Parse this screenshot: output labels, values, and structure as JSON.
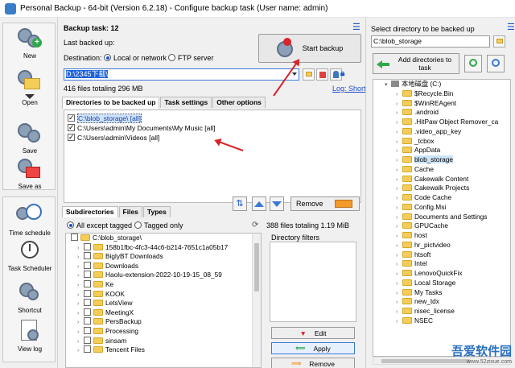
{
  "window": {
    "title": "Personal Backup - 64-bit (Version 6.2.18) - Configure backup task (User name: admin)"
  },
  "sidebar": {
    "buttons": [
      {
        "label": "New",
        "icon": "gear-add-icon"
      },
      {
        "label": "Open",
        "icon": "gear-open-icon"
      },
      {
        "label": "Save",
        "icon": "gear-save-icon"
      },
      {
        "label": "Save as",
        "icon": "gear-saveas-icon"
      },
      {
        "label": "Time schedule",
        "icon": "clock-icon"
      },
      {
        "label": "Task Scheduler",
        "icon": "task-scheduler-icon"
      },
      {
        "label": "Shortcut",
        "icon": "shortcut-icon"
      },
      {
        "label": "View log",
        "icon": "view-log-icon"
      }
    ]
  },
  "task": {
    "header": "Backup task: 12",
    "last_backed_up": "Last backed up:",
    "destination_label": "Destination:",
    "dest_local": "Local or network",
    "dest_ftp": "FTP server",
    "start_button": "Start backup",
    "path_value": "D:\\2345下载\\",
    "files_info": "416 files totaling 296 MB",
    "log_short": "Log: Short"
  },
  "tabs": [
    "Directories to be backed up",
    "Task settings",
    "Other options"
  ],
  "backup_dirs": [
    {
      "path": "C:\\blob_storage\\ [all]",
      "checked": true,
      "selected": true
    },
    {
      "path": "C:\\Users\\admin\\My Documents\\My Music [all]",
      "checked": true,
      "selected": false
    },
    {
      "path": "C:\\Users\\admin\\Videos [all]",
      "checked": true,
      "selected": false
    }
  ],
  "remove_button": "Remove",
  "subtabs": [
    "Subdirectories",
    "Files",
    "Types"
  ],
  "filter": {
    "all_except": "All except tagged",
    "tagged_only": "Tagged only",
    "total": "388 files totaling 1.19 MiB",
    "dir_filters_label": "Directory filters",
    "edit": "Edit",
    "apply": "Apply",
    "remove": "Remove"
  },
  "subdir_root": "C:\\blob_storage\\",
  "subdirs": [
    "158b1fbc-4fc3-44c6-b214-7651c1a05b17",
    "BiglyBT Downloads",
    "Downloads",
    "Haolu-extension-2022-10-19-15_08_59",
    "Ke",
    "KOOK",
    "LetsView",
    "MeetingX",
    "PersBackup",
    "Processing",
    "sinsam",
    "Tencent Files"
  ],
  "right": {
    "select_label": "Select directory to be backed up",
    "path_value": "C:\\blob_storage",
    "add_button": "Add directories to task",
    "root": "本地磁盘 (C:)",
    "items": [
      "$Recycle.Bin",
      "$WinREAgent",
      ".android",
      ".HitPaw Object Remover_ca",
      ".video_app_key",
      "_tcbox",
      "AppData",
      "blob_storage",
      "Cache",
      "Cakewalk Content",
      "Cakewalk Projects",
      "Code Cache",
      "Config.Msi",
      "Documents and Settings",
      "GPUCache",
      "host",
      "hr_pictvideo",
      "htsoft",
      "Intel",
      "LenovoQuickFix",
      "Local Storage",
      "My Tasks",
      "new_tdx",
      "nisec_license",
      "NSEC"
    ],
    "highlighted": "blob_storage"
  },
  "watermark": {
    "title": "吾爱软件园",
    "url": "www.52zixue.com"
  },
  "colors": {
    "accent": "#1a56c8",
    "arrow": "#d8242a",
    "folder": "#f3cd57"
  }
}
